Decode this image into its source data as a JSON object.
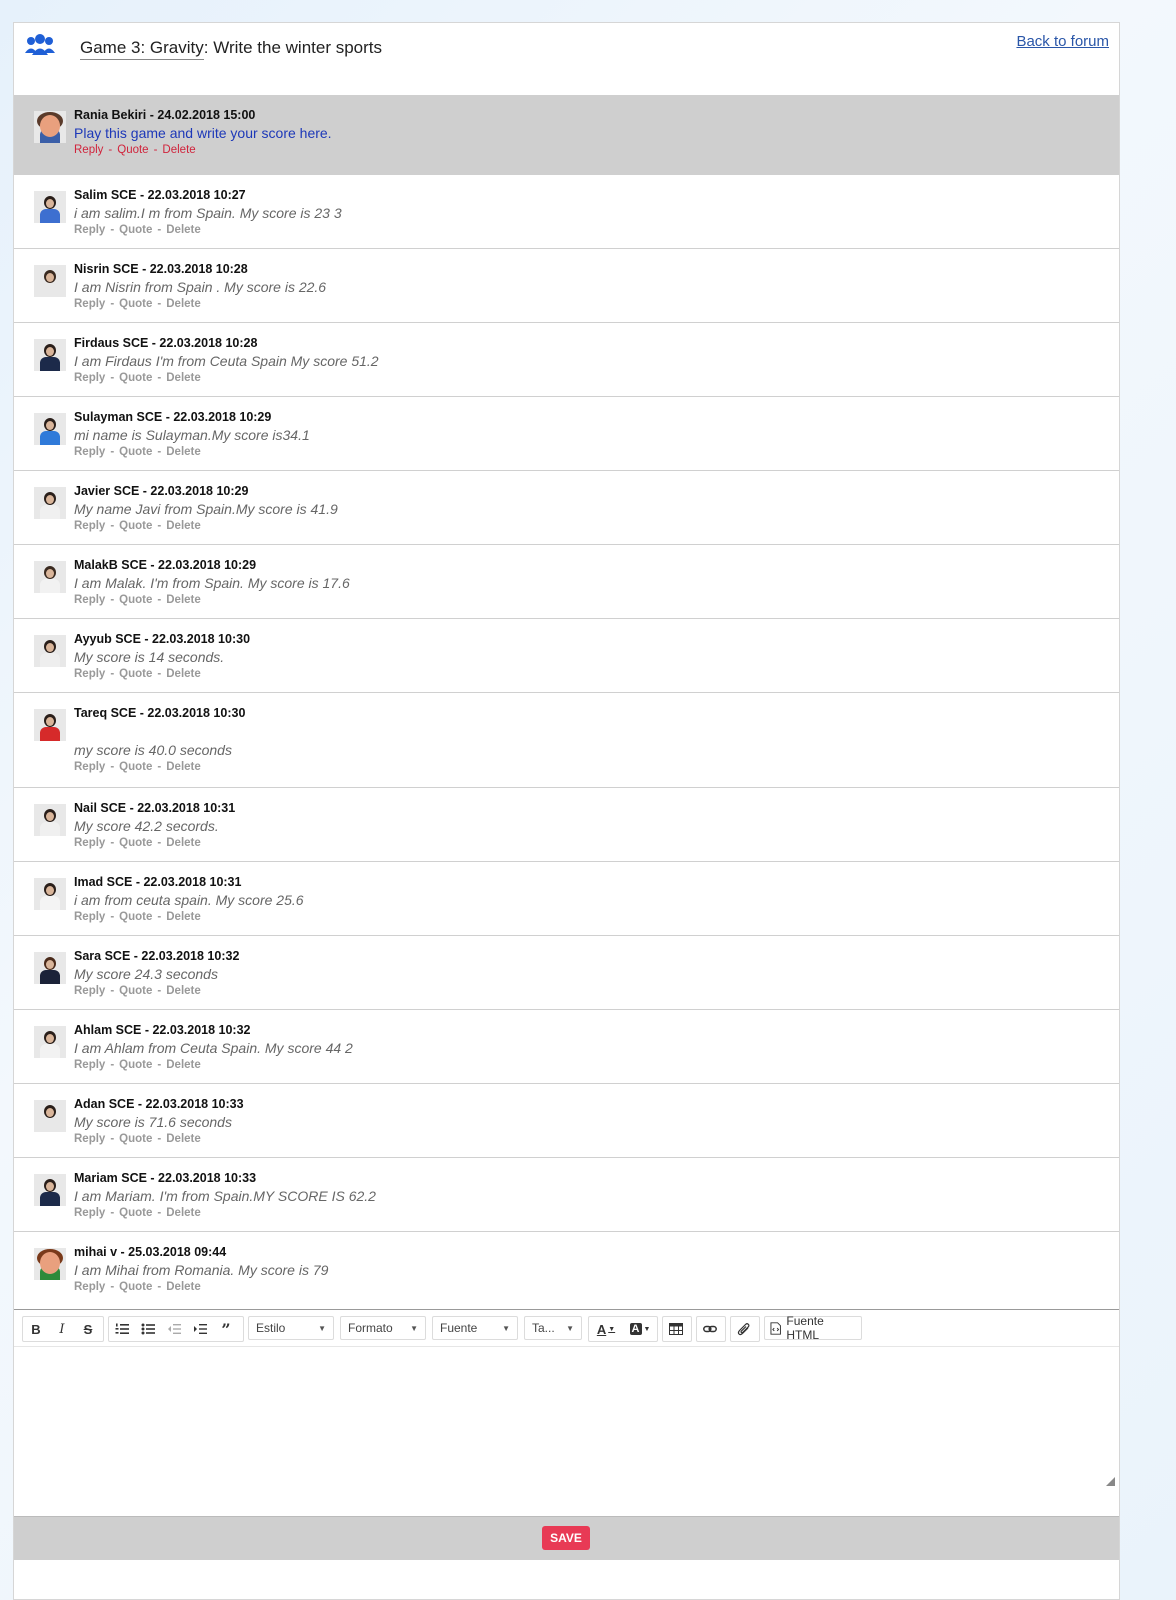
{
  "header": {
    "title_prefix": "Game 3: Gravity",
    "title_suffix": ": Write the winter sports",
    "back_link": "Back to forum"
  },
  "actions": {
    "reply": "Reply",
    "quote": "Quote",
    "delete": "Delete",
    "sep": "-"
  },
  "posts": [
    {
      "meta": "Rania Bekiri - 24.02.2018 15:00",
      "message": "Play this game and write your score here."
    },
    {
      "meta": "Salim SCE - 22.03.2018 10:27",
      "message": "i am salim.I m from Spain. My score is 23 3"
    },
    {
      "meta": "Nisrin SCE - 22.03.2018 10:28",
      "message": "I am Nisrin from Spain . My score is 22.6"
    },
    {
      "meta": "Firdaus SCE - 22.03.2018 10:28",
      "message": "I am Firdaus I'm from Ceuta Spain My score 51.2"
    },
    {
      "meta": "Sulayman SCE - 22.03.2018 10:29",
      "message": "mi name is Sulayman.My score is34.1"
    },
    {
      "meta": "Javier SCE - 22.03.2018 10:29",
      "message": "My name Javi from Spain.My score is 41.9"
    },
    {
      "meta": "MalakB SCE - 22.03.2018 10:29",
      "message": "I am Malak. I'm from Spain. My score is 17.6"
    },
    {
      "meta": "Ayyub SCE - 22.03.2018 10:30",
      "message": "My score is 14 seconds."
    },
    {
      "meta": "Tareq SCE - 22.03.2018 10:30",
      "message": "my score is 40.0 seconds"
    },
    {
      "meta": "Nail SCE - 22.03.2018 10:31",
      "message": "My score 42.2 secords."
    },
    {
      "meta": "Imad SCE - 22.03.2018 10:31",
      "message": "i am from ceuta spain. My score 25.6"
    },
    {
      "meta": "Sara SCE - 22.03.2018 10:32",
      "message": "My score 24.3 seconds"
    },
    {
      "meta": "Ahlam SCE - 22.03.2018 10:32",
      "message": "I am Ahlam from Ceuta Spain. My score 44 2"
    },
    {
      "meta": "Adan SCE - 22.03.2018 10:33",
      "message": "My score is 71.6 seconds"
    },
    {
      "meta": "Mariam SCE - 22.03.2018 10:33",
      "message": "I am  Mariam. I'm from Spain.MY SCORE IS 62.2"
    },
    {
      "meta": "mihai v - 25.03.2018 09:44",
      "message": "I am Mihai from Romania. My score is 79"
    }
  ],
  "editor": {
    "bold": "B",
    "italic": "I",
    "strike": "S",
    "style_select": "Estilo",
    "format_select": "Formato",
    "font_select": "Fuente",
    "size_select": "Ta...",
    "text_color": "A",
    "bg_color": "A",
    "source_button": "Fuente HTML"
  },
  "save_label": "SAVE"
}
